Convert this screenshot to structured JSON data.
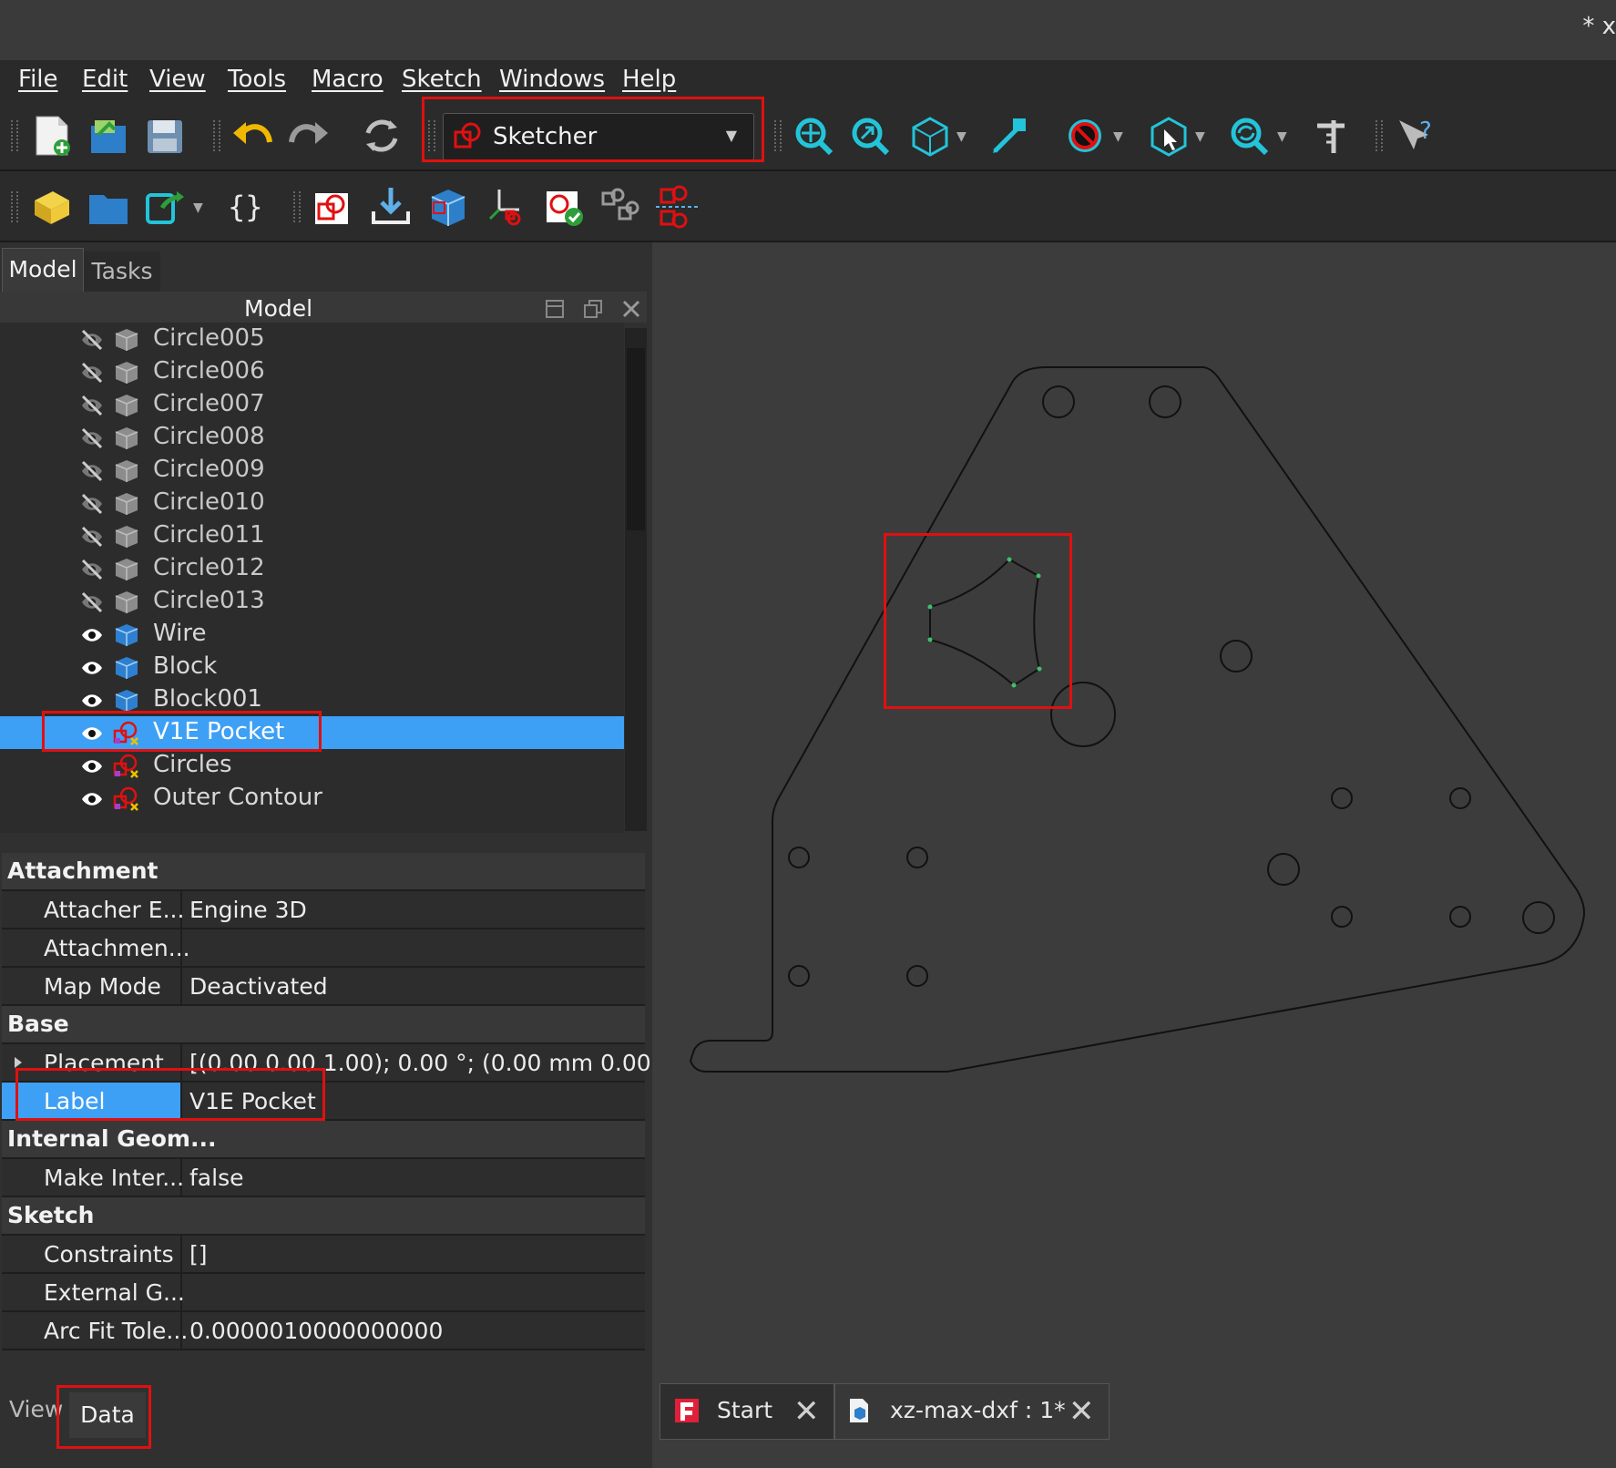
{
  "window": {
    "title": "* x"
  },
  "menu": [
    "File",
    "Edit",
    "View",
    "Tools",
    "Macro",
    "Sketch",
    "Windows",
    "Help"
  ],
  "toolbar": {
    "icons1": [
      "new-file-icon",
      "open-file-icon",
      "save-icon",
      "undo-icon",
      "redo-icon",
      "refresh-icon"
    ],
    "workbench": "Sketcher",
    "view_icons": [
      "fit-all-icon",
      "fit-selection-icon",
      "isometric-view-icon",
      "measure-icon",
      "draw-style-icon",
      "box-select-icon",
      "zoom-icon",
      "dimension-tool-icon",
      "whats-this-icon"
    ],
    "icons2": [
      "part-icon",
      "group-icon",
      "link-icon",
      "braces-icon",
      "new-sketch-icon",
      "export-icon",
      "part-box-icon",
      "attach-icon",
      "validate-sketch-icon",
      "merge-sketch-icon",
      "mirror-sketch-icon"
    ]
  },
  "left_tabs": {
    "model": "Model",
    "tasks": "Tasks"
  },
  "model_header": "Model",
  "tree": [
    {
      "label": "Circle005",
      "visible": false,
      "type": "solid-grey"
    },
    {
      "label": "Circle006",
      "visible": false,
      "type": "solid-grey"
    },
    {
      "label": "Circle007",
      "visible": false,
      "type": "solid-grey"
    },
    {
      "label": "Circle008",
      "visible": false,
      "type": "solid-grey"
    },
    {
      "label": "Circle009",
      "visible": false,
      "type": "solid-grey"
    },
    {
      "label": "Circle010",
      "visible": false,
      "type": "solid-grey"
    },
    {
      "label": "Circle011",
      "visible": false,
      "type": "solid-grey"
    },
    {
      "label": "Circle012",
      "visible": false,
      "type": "solid-grey"
    },
    {
      "label": "Circle013",
      "visible": false,
      "type": "solid-grey"
    },
    {
      "label": "Wire",
      "visible": true,
      "type": "solid-blue"
    },
    {
      "label": "Block",
      "visible": true,
      "type": "solid-blue"
    },
    {
      "label": "Block001",
      "visible": true,
      "type": "solid-blue"
    },
    {
      "label": "V1E Pocket",
      "visible": true,
      "type": "sketch",
      "selected": true
    },
    {
      "label": "Circles",
      "visible": true,
      "type": "sketch"
    },
    {
      "label": "Outer Contour",
      "visible": true,
      "type": "sketch"
    }
  ],
  "properties": {
    "attachment": "Attachment",
    "attacher_engine": {
      "name": "Attacher E...",
      "value": "Engine 3D"
    },
    "attachment_support": {
      "name": "Attachmen...",
      "value": ""
    },
    "map_mode": {
      "name": "Map Mode",
      "value": "Deactivated"
    },
    "base": "Base",
    "placement": {
      "name": "Placement",
      "value": "[(0.00 0.00 1.00); 0.00 °; (0.00 mm  0.00 ..."
    },
    "label": {
      "name": "Label",
      "value": "V1E Pocket"
    },
    "internal_geom": "Internal Geom...",
    "make_internals": {
      "name": "Make Inter...",
      "value": "false"
    },
    "sketch": "Sketch",
    "constraints": {
      "name": "Constraints",
      "value": "[]"
    },
    "external_geo": {
      "name": "External G...",
      "value": ""
    },
    "arc_fit": {
      "name": "Arc Fit Tole...",
      "value": "0.0000010000000000"
    }
  },
  "bottom_tabs": {
    "view": "View",
    "data": "Data"
  },
  "doc_tabs": [
    {
      "label": "Start",
      "icon": "freecad-icon"
    },
    {
      "label": "xz-max-dxf : 1*",
      "icon": "document-icon"
    }
  ],
  "colors": {
    "highlight": "#e01010",
    "selection": "#3ea0f5",
    "sketch_green": "#3fbf6f"
  }
}
